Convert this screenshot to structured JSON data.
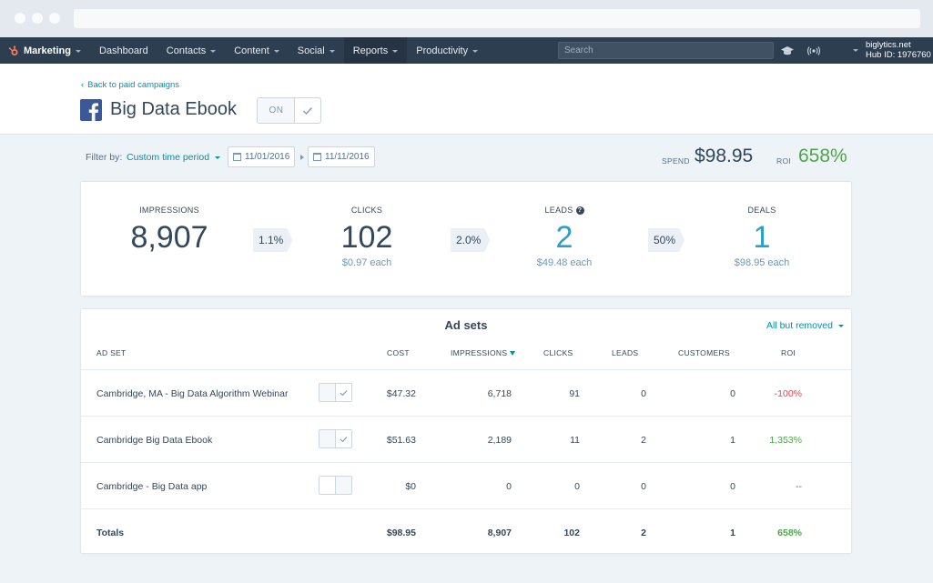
{
  "nav": {
    "brand": "Marketing",
    "items": [
      {
        "label": "Dashboard",
        "caret": false
      },
      {
        "label": "Contacts",
        "caret": true
      },
      {
        "label": "Content",
        "caret": true
      },
      {
        "label": "Social",
        "caret": true
      },
      {
        "label": "Reports",
        "caret": true,
        "active": true
      },
      {
        "label": "Productivity",
        "caret": true
      }
    ],
    "search_placeholder": "Search",
    "account_domain": "biglytics.net",
    "hub_id": "Hub ID: 1976760"
  },
  "header": {
    "back_link": "Back to paid campaigns",
    "campaign_title": "Big Data Ebook",
    "toggle_label": "ON"
  },
  "filter": {
    "label": "Filter by:",
    "period": "Custom time period",
    "start_date": "11/01/2016",
    "end_date": "11/11/2016"
  },
  "summary": {
    "spend_label": "SPEND",
    "spend_value": "$98.95",
    "roi_label": "ROI",
    "roi_value": "658%"
  },
  "funnel": {
    "impressions": {
      "label": "IMPRESSIONS",
      "value": "8,907"
    },
    "rate1": "1.1%",
    "clicks": {
      "label": "CLICKS",
      "value": "102",
      "each": "$0.97 each"
    },
    "rate2": "2.0%",
    "leads": {
      "label": "LEADS",
      "value": "2",
      "each": "$49.48 each"
    },
    "rate3": "50%",
    "deals": {
      "label": "DEALS",
      "value": "1",
      "each": "$98.95 each"
    }
  },
  "adsets": {
    "title": "Ad sets",
    "filter": "All but removed",
    "columns": {
      "adset": "AD SET",
      "cost": "COST",
      "impressions": "IMPRESSIONS",
      "clicks": "CLICKS",
      "leads": "LEADS",
      "customers": "CUSTOMERS",
      "roi": "ROI"
    },
    "rows": [
      {
        "name": "Cambridge, MA - Big Data Algorithm Webinar",
        "on": true,
        "cost": "$47.32",
        "impressions": "6,718",
        "clicks": "91",
        "leads": "0",
        "customers": "0",
        "roi": "-100%",
        "roi_tone": "neg"
      },
      {
        "name": "Cambridge Big Data Ebook",
        "on": true,
        "cost": "$51.63",
        "impressions": "2,189",
        "clicks": "11",
        "leads": "2",
        "customers": "1",
        "roi": "1,353%",
        "roi_tone": "pos"
      },
      {
        "name": "Cambridge - Big Data app",
        "on": false,
        "cost": "$0",
        "impressions": "0",
        "clicks": "0",
        "leads": "0",
        "customers": "0",
        "roi": "--",
        "roi_tone": "none"
      }
    ],
    "totals": {
      "name": "Totals",
      "cost": "$98.95",
      "impressions": "8,907",
      "clicks": "102",
      "leads": "2",
      "customers": "1",
      "roi": "658%"
    }
  },
  "colors": {
    "nav_bg": "#2d3e50",
    "link": "#0091ae",
    "positive": "#4fa547",
    "negative": "#e1474f",
    "funnel_blue": "#2d9ec4",
    "facebook": "#3b5998"
  }
}
